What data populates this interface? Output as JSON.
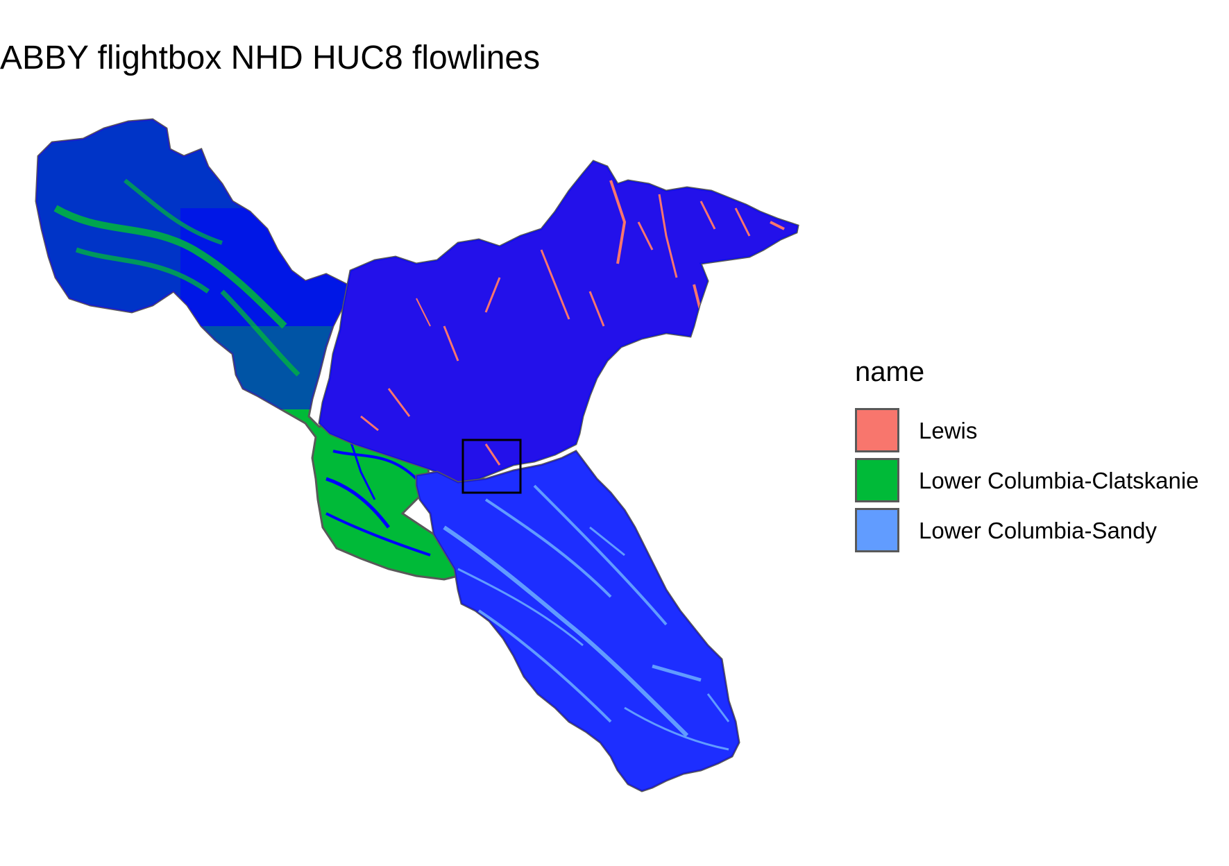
{
  "title": "ABBY flightbox NHD HUC8 flowlines",
  "legend": {
    "title": "name",
    "items": [
      {
        "label": "Lewis",
        "color": "#F8766D"
      },
      {
        "label": "Lower Columbia-Clatskanie",
        "color": "#00BA38"
      },
      {
        "label": "Lower Columbia-Sandy",
        "color": "#619CFF"
      }
    ]
  },
  "colors": {
    "flowlines": "#0000FF",
    "boundary": "#595959",
    "flightbox": "#000000"
  }
}
